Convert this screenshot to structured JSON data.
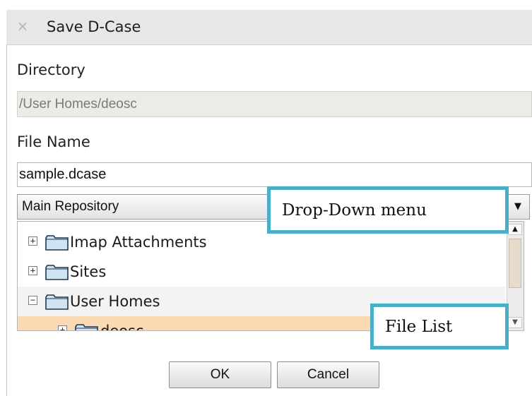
{
  "dialog": {
    "title": "Save D-Case",
    "directory_label": "Directory",
    "directory_value": "/User Homes/deosc",
    "file_name_label": "File Name",
    "file_name_value": "sample.dcase",
    "repository_selected": "Main Repository"
  },
  "tree": {
    "items": [
      {
        "label": "Imap Attachments",
        "expander": "+",
        "state": "collapsed"
      },
      {
        "label": "Sites",
        "expander": "+",
        "state": "collapsed"
      },
      {
        "label": "User Homes",
        "expander": "−",
        "state": "expanded"
      },
      {
        "label": "deosc",
        "expander": "+",
        "state": "selected"
      }
    ]
  },
  "buttons": {
    "ok": "OK",
    "cancel": "Cancel"
  },
  "annotations": {
    "dropdown_callout": "Drop-Down menu",
    "filelist_callout": "File List",
    "callout_color": "#4aafc6"
  },
  "icons": {
    "close": "×",
    "scroll_up": "▲",
    "scroll_down": "▼",
    "dropdown": "▼"
  },
  "colors": {
    "selected_row": "#fbd9b3",
    "titlebar": "#e7e7e7"
  }
}
